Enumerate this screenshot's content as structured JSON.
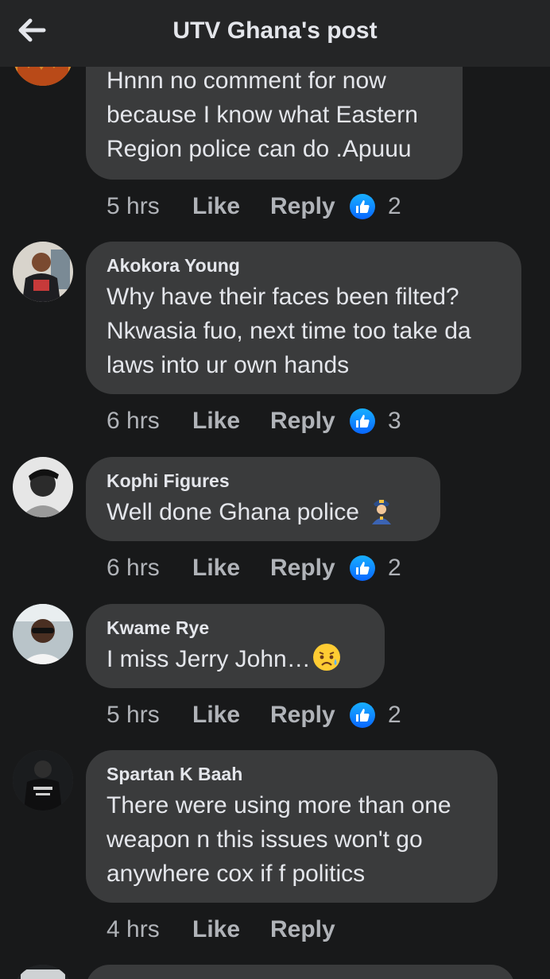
{
  "header": {
    "title": "UTV Ghana's post",
    "back_icon": "arrow-left-icon"
  },
  "comments": [
    {
      "author": "",
      "text": "Hnnn no comment for now\nbecause I know what Eastern\nRegion police can do .Apuuu",
      "time": "5 hrs",
      "like_label": "Like",
      "reply_label": "Reply",
      "reaction_count": "2"
    },
    {
      "author": "Akokora Young",
      "text": "Why have their faces been filted?\nNkwasia fuo, next time too take da\nlaws into ur own hands",
      "time": "6 hrs",
      "like_label": "Like",
      "reply_label": "Reply",
      "reaction_count": "3"
    },
    {
      "author": "Kophi Figures",
      "text": "Well  done Ghana police",
      "emoji": "police-officer-emoji",
      "time": "6 hrs",
      "like_label": "Like",
      "reply_label": "Reply",
      "reaction_count": "2"
    },
    {
      "author": "Kwame Rye",
      "text": "I miss Jerry John…",
      "emoji": "sad-but-relieved-face-emoji",
      "time": "5 hrs",
      "like_label": "Like",
      "reply_label": "Reply",
      "reaction_count": "2"
    },
    {
      "author": "Spartan K Baah",
      "text": "There were using more than one\nweapon n this issues won't go\nanywhere cox if f politics",
      "time": "4 hrs",
      "like_label": "Like",
      "reply_label": "Reply"
    }
  ],
  "colors": {
    "background": "#18191a",
    "bubble": "#3a3b3c",
    "text": "#e4e6eb",
    "secondary_text": "#b0b3b8",
    "like_blue": "#0866ff"
  }
}
